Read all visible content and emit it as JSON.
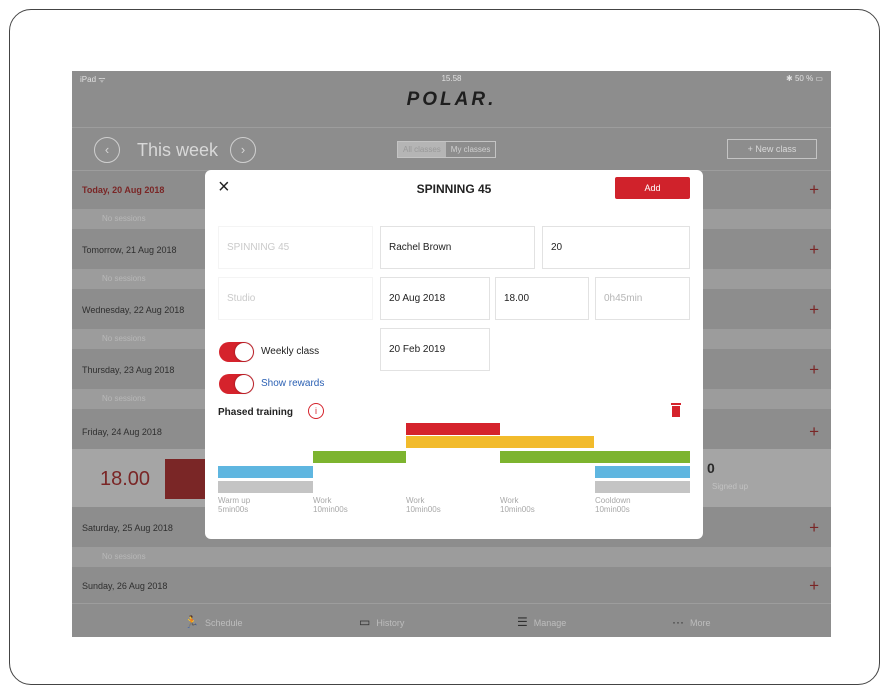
{
  "status_bar": {
    "carrier": "iPad ᯤ",
    "time": "15.58",
    "battery": "✱ 50 % ▭"
  },
  "app": {
    "logo": "POLAR."
  },
  "week": {
    "prev": "‹",
    "title": "This week",
    "next": "›"
  },
  "filter": {
    "all_label": "All classes",
    "my_label": "My classes"
  },
  "new_class_label": "+ New class",
  "days": [
    {
      "label": "Today, 20 Aug 2018",
      "no_sessions": "No sessions"
    },
    {
      "label": "Tomorrow, 21 Aug 2018",
      "no_sessions": "No sessions"
    },
    {
      "label": "Wednesday, 22 Aug 2018",
      "no_sessions": "No sessions"
    },
    {
      "label": "Thursday, 23 Aug 2018",
      "no_sessions": "No sessions"
    },
    {
      "label": "Friday, 24 Aug 2018"
    },
    {
      "label": "Saturday, 25 Aug 2018",
      "no_sessions": "No sessions"
    },
    {
      "label": "Sunday, 26 Aug 2018"
    }
  ],
  "session": {
    "time": "18.00",
    "count": "0",
    "signed_up": "Signed up"
  },
  "tabs": [
    {
      "label": "Schedule",
      "icon": "runner-icon"
    },
    {
      "label": "History",
      "icon": "calendar-icon"
    },
    {
      "label": "Manage",
      "icon": "list-icon"
    },
    {
      "label": "More",
      "icon": "more-icon"
    }
  ],
  "modal": {
    "close": "×",
    "title": "SPINNING 45",
    "add_label": "Add",
    "fields": {
      "class_name_placeholder": "SPINNING 45",
      "instructor": "Rachel Brown",
      "capacity": "20",
      "location_placeholder": "Studio",
      "date": "20 Aug 2018",
      "start_time": "18.00",
      "duration": "0h45min",
      "end_date": "20 Feb 2019"
    },
    "weekly_class_label": "Weekly class",
    "weekly_class_on": true,
    "show_rewards_label": "Show rewards",
    "show_rewards_on": true,
    "phased_training_label": "Phased training",
    "info_icon": "i",
    "phases": [
      {
        "name": "Warm up",
        "duration": "5min00s"
      },
      {
        "name": "Work",
        "duration": "10min00s"
      },
      {
        "name": "Work",
        "duration": "10min00s"
      },
      {
        "name": "Work",
        "duration": "10min00s"
      },
      {
        "name": "Cooldown",
        "duration": "10min00s"
      }
    ],
    "zone_colors": {
      "zone1": "#c4c4c4",
      "zone2": "#5fb6e0",
      "zone3": "#7db42f",
      "zone4": "#f2bb2c",
      "zone5": "#d5232c"
    }
  }
}
